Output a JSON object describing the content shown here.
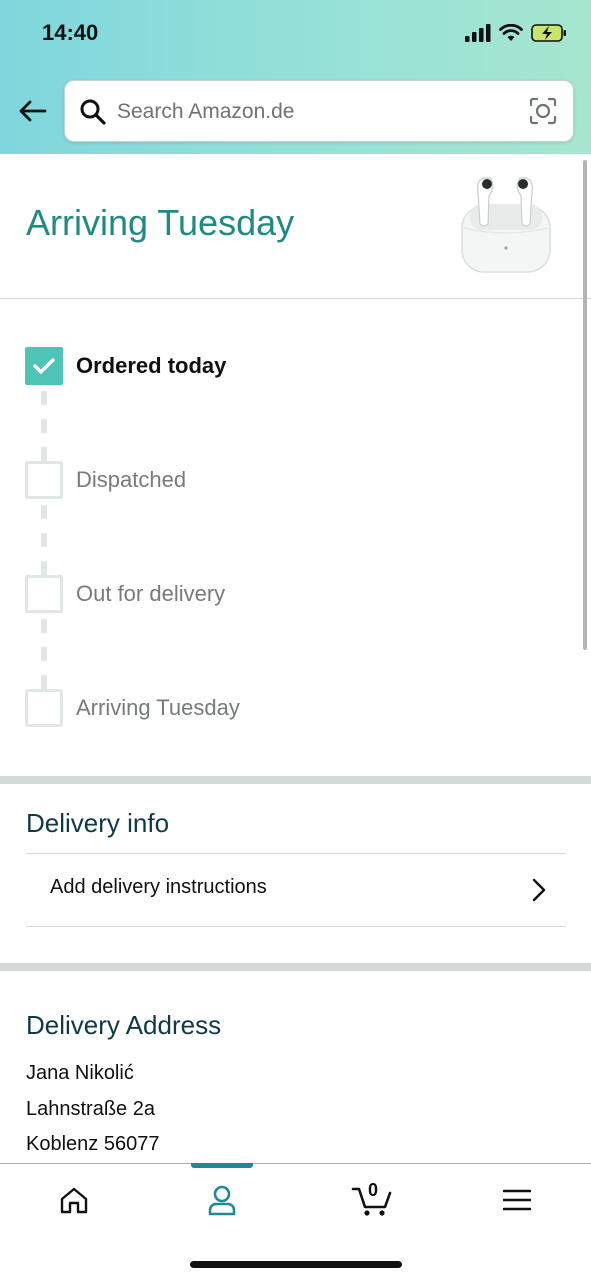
{
  "status_bar": {
    "time": "14:40"
  },
  "search": {
    "placeholder": "Search Amazon.de"
  },
  "arriving": {
    "title": "Arriving Tuesday"
  },
  "tracker": {
    "steps": [
      {
        "label": "Ordered today",
        "done": true
      },
      {
        "label": "Dispatched",
        "done": false
      },
      {
        "label": "Out for delivery",
        "done": false
      },
      {
        "label": "Arriving Tuesday",
        "done": false
      }
    ]
  },
  "delivery_info": {
    "title": "Delivery info",
    "instructions_label": "Add delivery instructions"
  },
  "delivery_address": {
    "title": "Delivery Address",
    "name": "Jana Nikolić",
    "street": "Lahnstraße 2a",
    "city": "Koblenz 56077"
  },
  "tabbar": {
    "cart_count": "0",
    "active_tab": "account"
  },
  "colors": {
    "accent_teal": "#1f8a82",
    "check_green": "#4fc3b6",
    "header_gradient_start": "#7fd6dd",
    "header_gradient_end": "#a6e6cf"
  }
}
